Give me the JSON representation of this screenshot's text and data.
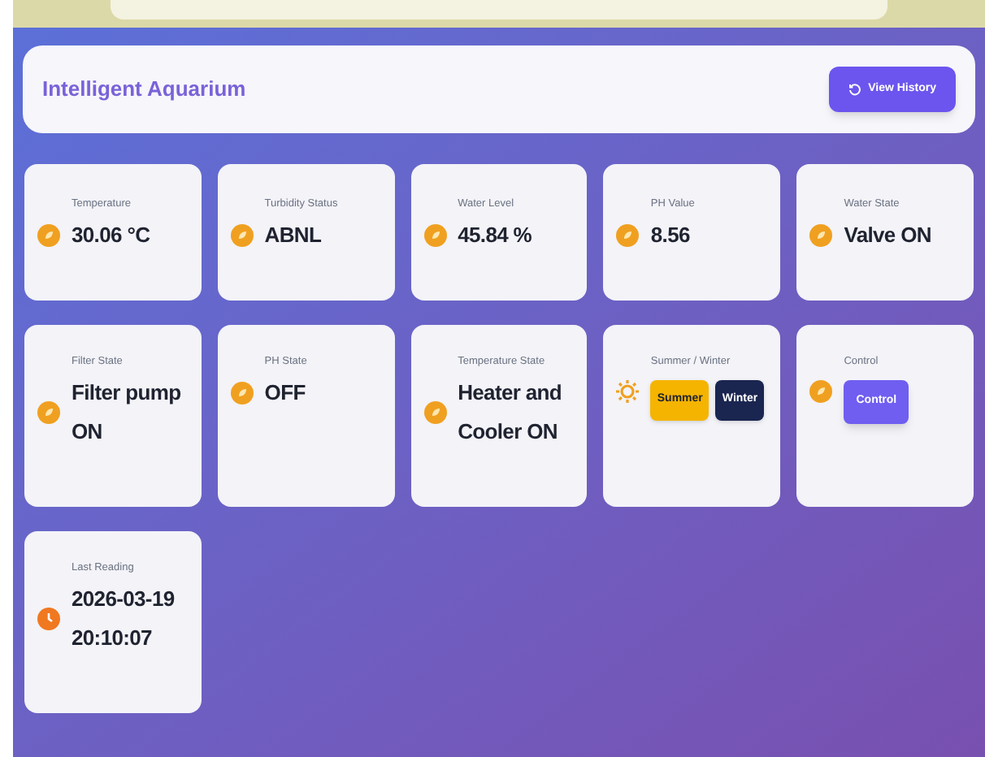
{
  "header": {
    "title": "Intelligent Aquarium",
    "button": "View History"
  },
  "cards": [
    {
      "kind": "value",
      "label": "Temperature",
      "value": "30.06 °C"
    },
    {
      "kind": "value",
      "label": "Turbidity Status",
      "value": "ABNL"
    },
    {
      "kind": "value",
      "label": "Water Level",
      "value": "45.84 %"
    },
    {
      "kind": "value",
      "label": "PH Value",
      "value": "8.56"
    },
    {
      "kind": "value",
      "label": "Water State",
      "value": "Valve ON"
    },
    {
      "kind": "value",
      "label": "Filter State",
      "value": "Filter pump ON"
    },
    {
      "kind": "value",
      "label": "PH State",
      "value": "OFF"
    },
    {
      "kind": "value",
      "label": "Temperature State",
      "value": "Heater and Cooler ON"
    },
    {
      "kind": "season",
      "label": "Summer / Winter",
      "buttons": [
        {
          "label": "Summer",
          "color": "#f5b400"
        },
        {
          "label": "Winter",
          "color": "#1a2550"
        }
      ]
    },
    {
      "kind": "control",
      "label": "Control",
      "button": "Control"
    },
    {
      "kind": "time",
      "label": "Last Reading",
      "value": "2026-03-19 20:10:07"
    }
  ]
}
